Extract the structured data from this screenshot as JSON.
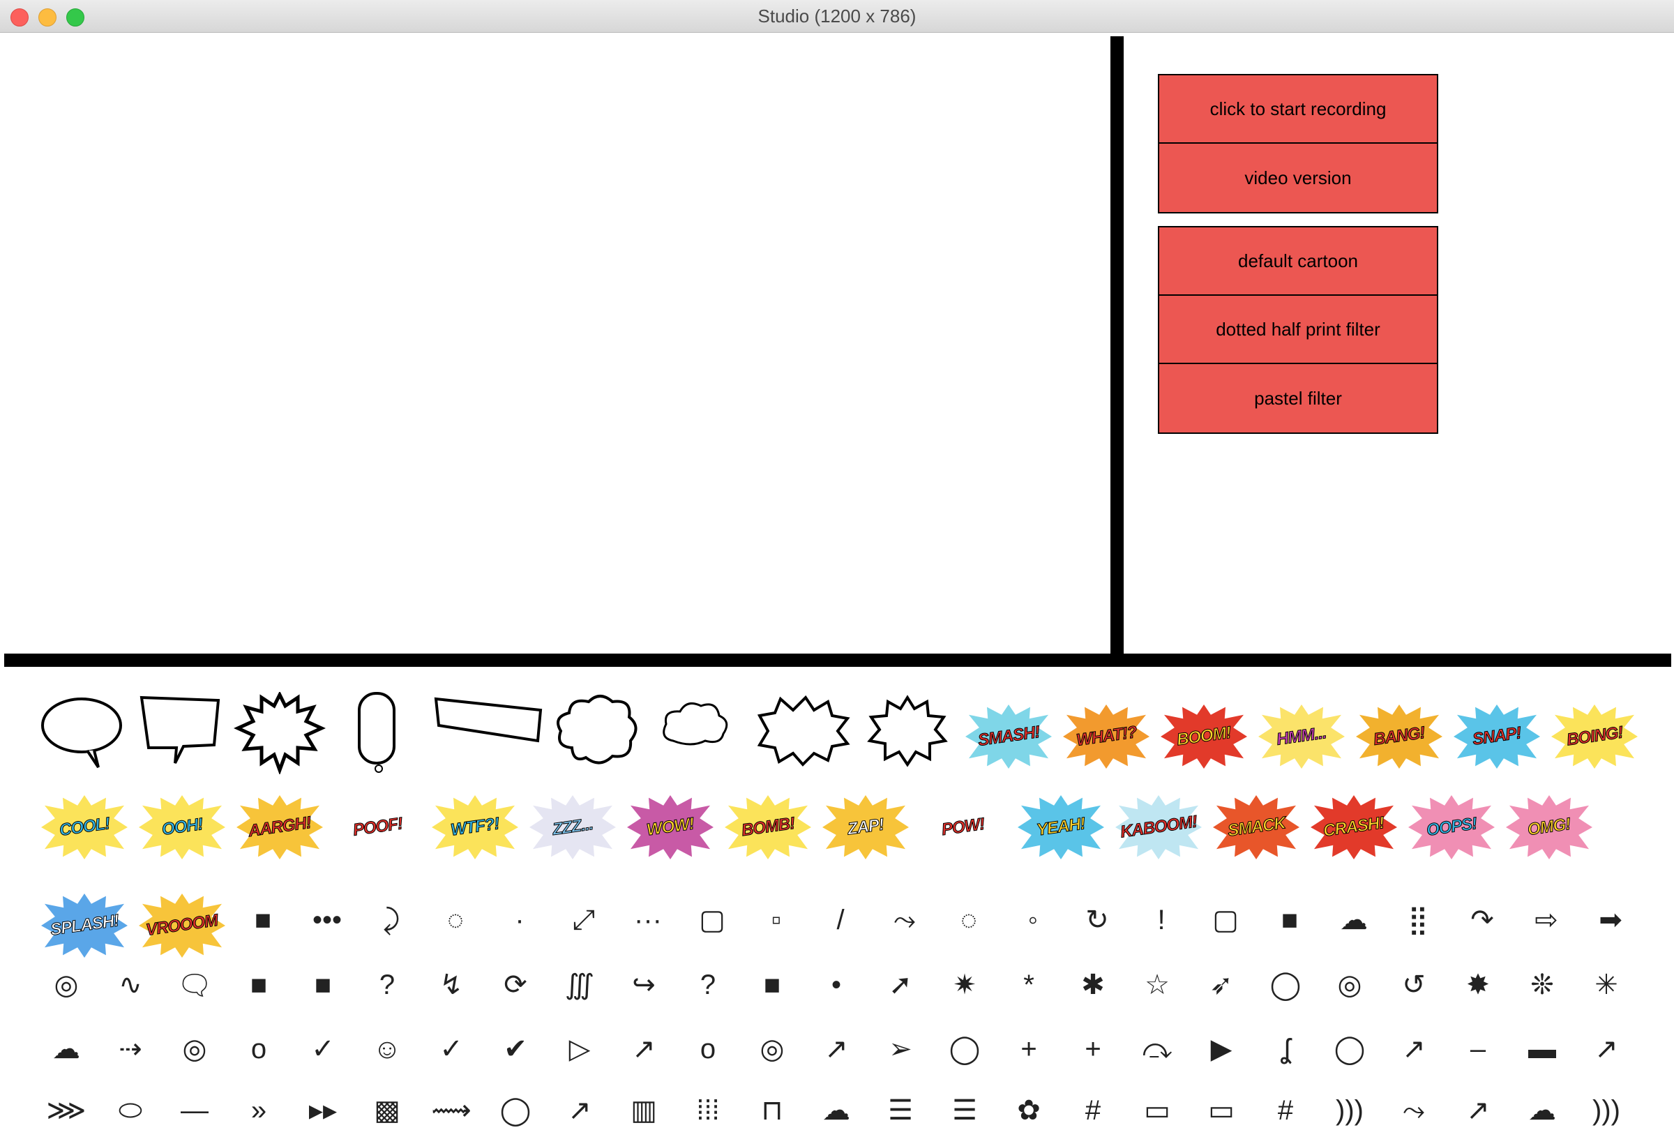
{
  "window": {
    "title": "Studio (1200 x 786)"
  },
  "controls": {
    "recording": [
      "click to start recording",
      "video version"
    ],
    "filters": [
      "default cartoon",
      "dotted half print filter",
      "pastel filter"
    ]
  },
  "colors": {
    "button_bg": "#ec5752",
    "divider": "#000000"
  },
  "palette": {
    "bubbles": [
      "speech-bubble-icon",
      "speech-bubble-jagged-icon",
      "starburst-bubble-icon",
      "tall-bubble-icon",
      "box-caption-icon",
      "cloud-thought-icon",
      "small-cloud-icon",
      "scalloped-burst-icon",
      "star-burst-icon"
    ],
    "words_row1": [
      "SMASH!",
      "WHAT!?",
      "BOOM!",
      "HMM...",
      "BANG!",
      "SNAP!",
      "BOING!"
    ],
    "words_row2": [
      "COOL!",
      "OOH!",
      "AARGH!",
      "POOF!",
      "WTF?!",
      "ZZZ...",
      "WOW!",
      "BOMB!",
      "ZAP!",
      "POW!",
      "YEAH!",
      "KABOOM!",
      "SMACK",
      "CRASH!",
      "OOPS!",
      "OMG!"
    ],
    "words_row3": [
      "SPLASH!",
      "VROOOM"
    ],
    "icons_row3": [
      "■",
      "•••",
      "⤸",
      "◌",
      "·",
      "⤢",
      "···",
      "▢",
      "▫",
      "/",
      "⤳",
      "◌",
      "◦",
      "↻",
      "!",
      "▢",
      "■",
      "☁",
      "⣿",
      "↷",
      "⇨",
      "➡"
    ],
    "icons_row4": [
      "◎",
      "∿",
      "🗨",
      "■",
      "■",
      "?",
      "↯",
      "⟳",
      "∭",
      "↪",
      "?",
      "■",
      "•",
      "➚",
      "✷",
      "*",
      "✱",
      "☆",
      "➶",
      "◯",
      "◎",
      "↺",
      "✸",
      "❊",
      "✳"
    ],
    "icons_row5": [
      "☁",
      "⇢",
      "◎",
      "o",
      "✓",
      "☺",
      "✓",
      "✔",
      "▷",
      "↗",
      "o",
      "◎",
      "↗",
      "➢",
      "◯",
      "+",
      "+",
      "⤼",
      "▶",
      "ʆ",
      "◯",
      "↗",
      "–",
      "▬",
      "↗"
    ],
    "icons_row6": [
      "⋙",
      "⬭",
      "—",
      "»",
      "▸▸",
      "▩",
      "⟿",
      "◯",
      "↗",
      "▥",
      "⁞⁞⁞",
      "⊓",
      "☁",
      "☰",
      "☰",
      "✿",
      "#",
      "▭",
      "▭",
      "#",
      ")))",
      "⤳",
      "↗",
      "☁",
      ")))"
    ]
  }
}
